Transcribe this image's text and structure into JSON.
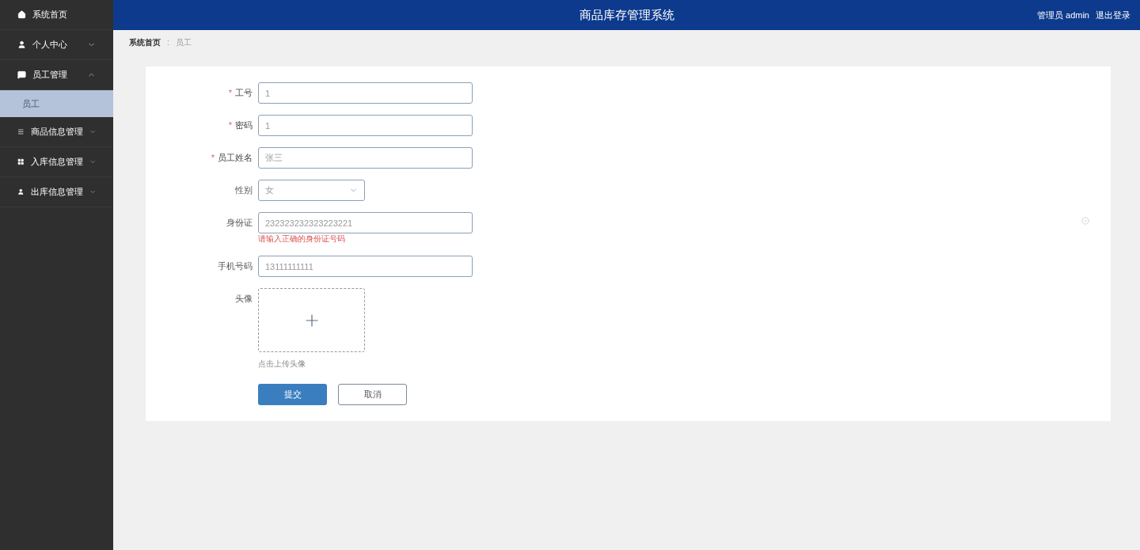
{
  "header": {
    "title": "商品库存管理系统",
    "user": "管理员 admin",
    "logout": "退出登录"
  },
  "sidebar": {
    "items": [
      {
        "kind": "link",
        "label": "系统首页"
      },
      {
        "kind": "group",
        "label": "个人中心",
        "expanded": false
      },
      {
        "kind": "group",
        "label": "员工管理",
        "expanded": true,
        "children": [
          {
            "label": "员工",
            "selected": true
          }
        ]
      },
      {
        "kind": "group",
        "label": "商品信息管理",
        "expanded": false
      },
      {
        "kind": "group",
        "label": "入库信息管理",
        "expanded": false
      },
      {
        "kind": "group",
        "label": "出库信息管理",
        "expanded": false
      }
    ]
  },
  "breadcrumb": {
    "separator": ":",
    "items": [
      {
        "label": "系统首页",
        "current": false
      },
      {
        "label": "员工",
        "current": true
      }
    ]
  },
  "form": {
    "required_mark": "*",
    "fields": [
      {
        "kind": "text",
        "label": "工号",
        "required": true,
        "value": "1"
      },
      {
        "kind": "text",
        "label": "密码",
        "required": true,
        "value": "1"
      },
      {
        "kind": "text",
        "label": "员工姓名",
        "required": true,
        "value": "张三"
      },
      {
        "kind": "select",
        "label": "性别",
        "required": false,
        "value": "女"
      },
      {
        "kind": "text",
        "label": "身份证",
        "required": false,
        "value": "232323232323223221",
        "error": "请输入正确的身份证号码"
      },
      {
        "kind": "text",
        "label": "手机号码",
        "required": false,
        "value": "13111111111"
      },
      {
        "kind": "upload",
        "label": "头像",
        "required": false,
        "hint": "点击上传头像"
      }
    ],
    "buttons": [
      {
        "label": "提交",
        "primary": true
      },
      {
        "label": "取消",
        "primary": false
      }
    ]
  }
}
